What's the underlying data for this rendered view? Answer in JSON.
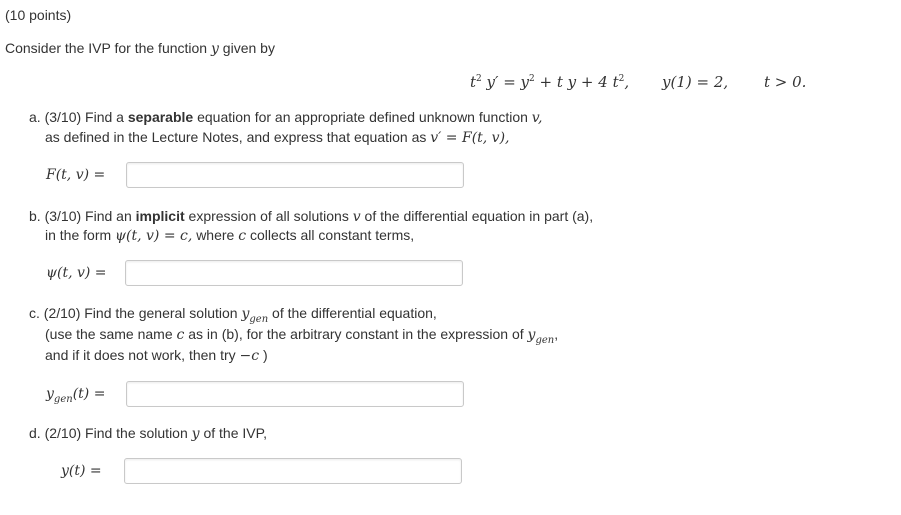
{
  "header": {
    "points": "(10 points)"
  },
  "intro": {
    "text": "Consider the IVP for the function",
    "var": "y",
    "tail": "given by"
  },
  "equation": {
    "lhs_base": "t",
    "lhs_sup": "2",
    "lhs_y": "y′",
    "rhs": "= y",
    "rhs_sup": "2",
    "rhs_rest": "+ t y + 4 t",
    "rhs_sup2": "2",
    "comma": ",",
    "initial": "y(1) = 2,",
    "domain": "t > 0."
  },
  "part_a": {
    "line1_pre": "a. (3/10) Find a",
    "line1_bold": "separable",
    "line1_post": "equation for an appropriate defined unknown function",
    "line1_var": "v,",
    "line2_pre": "as defined in the Lecture Notes, and express that equation as",
    "line2_eq": "v′ = F(t, v),",
    "label": "F(t, v) =",
    "input_value": ""
  },
  "part_b": {
    "line1_pre": "b. (3/10) Find an",
    "line1_bold": "implicit",
    "line1_mid": "expression of all solutions",
    "line1_var": "v",
    "line1_post": "of the differential equation in part (a),",
    "line2_pre": "in the form",
    "line2_eq": "ψ(t, v) = c,",
    "line2_mid": "where",
    "line2_c": "c",
    "line2_post": "collects all constant terms,",
    "label": "ψ(t, v) =",
    "input_value": ""
  },
  "part_c": {
    "line1_pre": "c. (2/10) Find the general solution",
    "line1_var": "y",
    "line1_sub": "gen",
    "line1_post": "of the differential equation,",
    "line2_pre": "(use the same name",
    "line2_c": "c",
    "line2_mid": "as in (b), for the arbitrary constant in the expression of",
    "line2_var": "y",
    "line2_sub": "gen",
    "line2_post": ",",
    "line3_pre": "and if it does not work, then try",
    "line3_eq": "−c",
    "line3_post": ")",
    "label_var": "y",
    "label_sub": "gen",
    "label_post": "(t) =",
    "input_value": ""
  },
  "part_d": {
    "line1_pre": "d. (2/10) Find the solution",
    "line1_var": "y",
    "line1_post": "of the IVP,",
    "label": "y(t) =",
    "input_value": ""
  }
}
